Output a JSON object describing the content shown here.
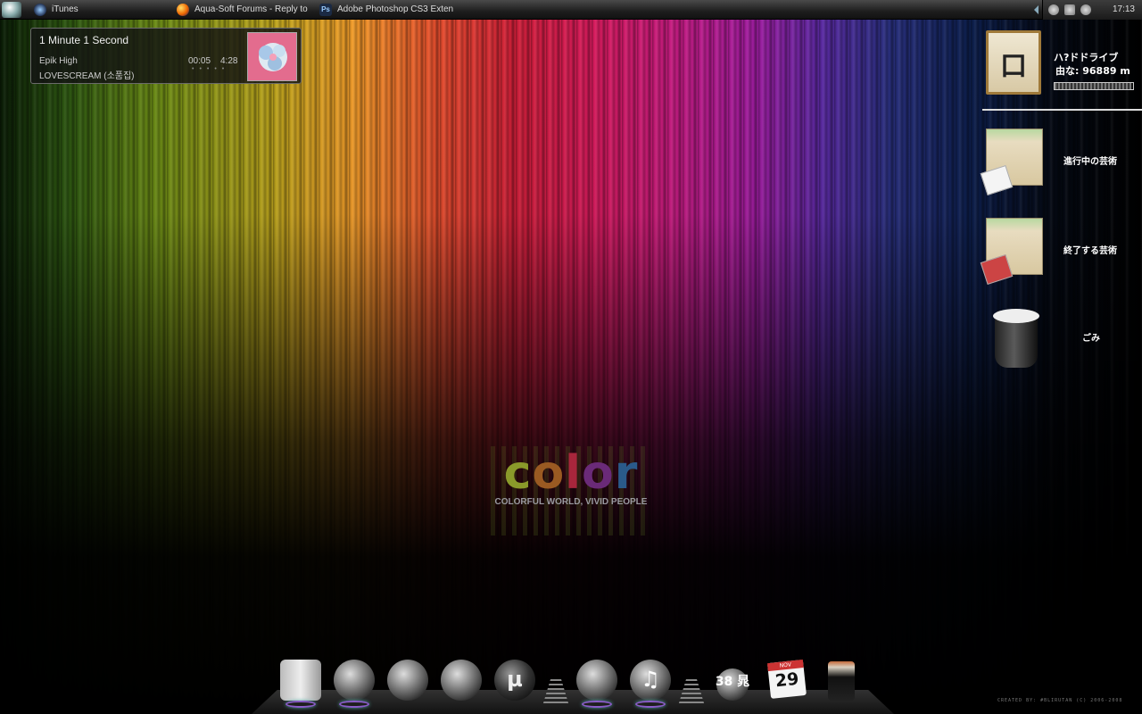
{
  "taskbar": {
    "tasks": [
      {
        "label": "iTunes",
        "icon": "itunes-icon"
      },
      {
        "label": "Aqua-Soft Forums - Reply to ...",
        "icon": "firefox-icon"
      },
      {
        "label": "Adobe Photoshop CS3 Exten...",
        "icon": "photoshop-icon",
        "badge": "Ps"
      }
    ],
    "clock": "17:13"
  },
  "now_playing": {
    "title": "1 Minute 1 Second",
    "artist": "Epik High",
    "album": "LOVESCREAM (소품집)",
    "elapsed": "00:05",
    "total": "4:28"
  },
  "wallpaper": {
    "word": [
      "c",
      "o",
      "l",
      "o",
      "r"
    ],
    "tagline": "COLORFUL WORLD, VIVID PEOPLE"
  },
  "shelf": {
    "hdd_title": "ハ?ドドライブ",
    "hdd_free": "由な: 96889 m",
    "hdd_used_fraction": 0.98,
    "items": [
      {
        "label": "進行中の芸術",
        "icon": "folder-box-icon"
      },
      {
        "label": "終了する芸術",
        "icon": "folder-box-icon"
      },
      {
        "label": "ごみ",
        "icon": "trash-icon"
      }
    ]
  },
  "dock": {
    "weather_temp": "38",
    "weather_glyph": "晁",
    "calendar_month": "NOV",
    "calendar_day": "29",
    "utorrent_glyph": "µ"
  },
  "credits": "CREATED BY: #BLIRUTAN (C) 2006-2008"
}
